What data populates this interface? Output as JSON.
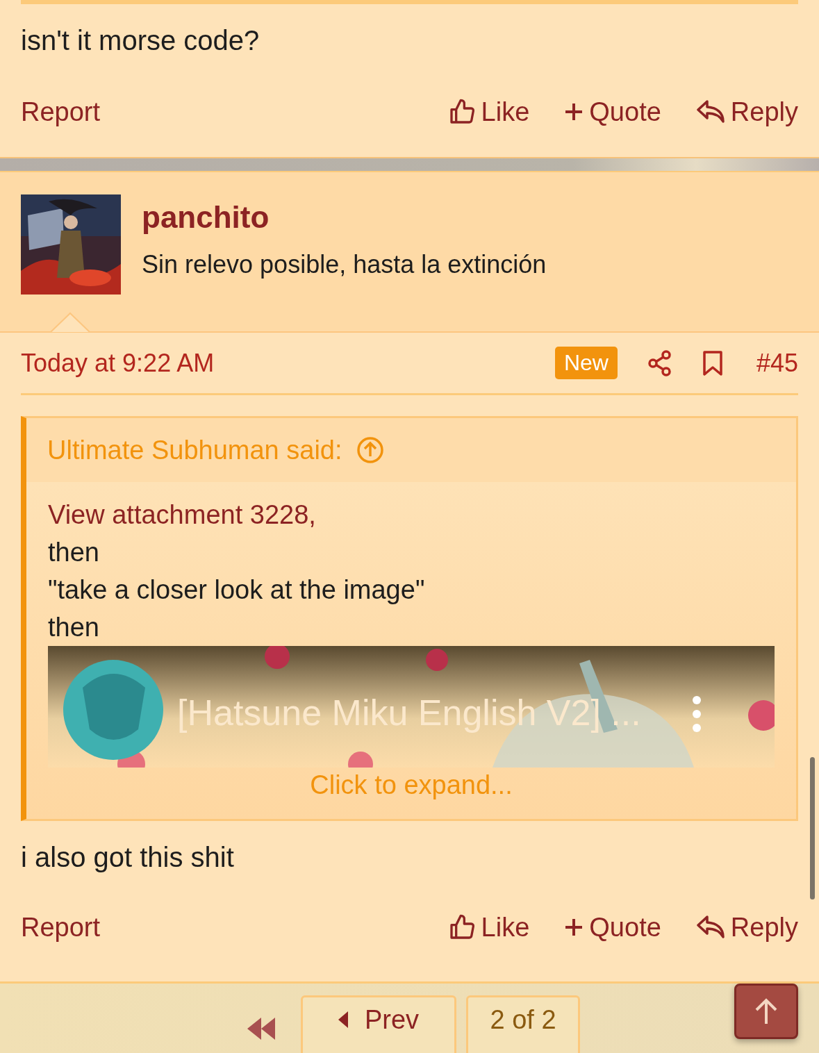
{
  "top_post": {
    "message": "isn't it morse code?",
    "actions": {
      "report": "Report",
      "like": "Like",
      "quote": "Quote",
      "reply": "Reply"
    }
  },
  "post": {
    "user": {
      "name": "panchito",
      "title": "Sin relevo posible, hasta la extinción"
    },
    "date": "Today at 9:22 AM",
    "badge": "New",
    "number": "#45",
    "quote": {
      "author": "Ultimate Subhuman said:",
      "lines": [
        {
          "kind": "link",
          "text": "View attachment 3228,"
        },
        {
          "kind": "text",
          "text": "then"
        },
        {
          "kind": "text",
          "text": "\"take a closer look at the image\""
        },
        {
          "kind": "text",
          "text": "then"
        }
      ],
      "video_title": "[Hatsune Miku English V2] ...",
      "expand": "Click to expand..."
    },
    "message": "i also got this shit",
    "actions": {
      "report": "Report",
      "like": "Like",
      "quote": "Quote",
      "reply": "Reply"
    }
  },
  "pagination": {
    "prev": "Prev",
    "page": "2 of 2"
  }
}
